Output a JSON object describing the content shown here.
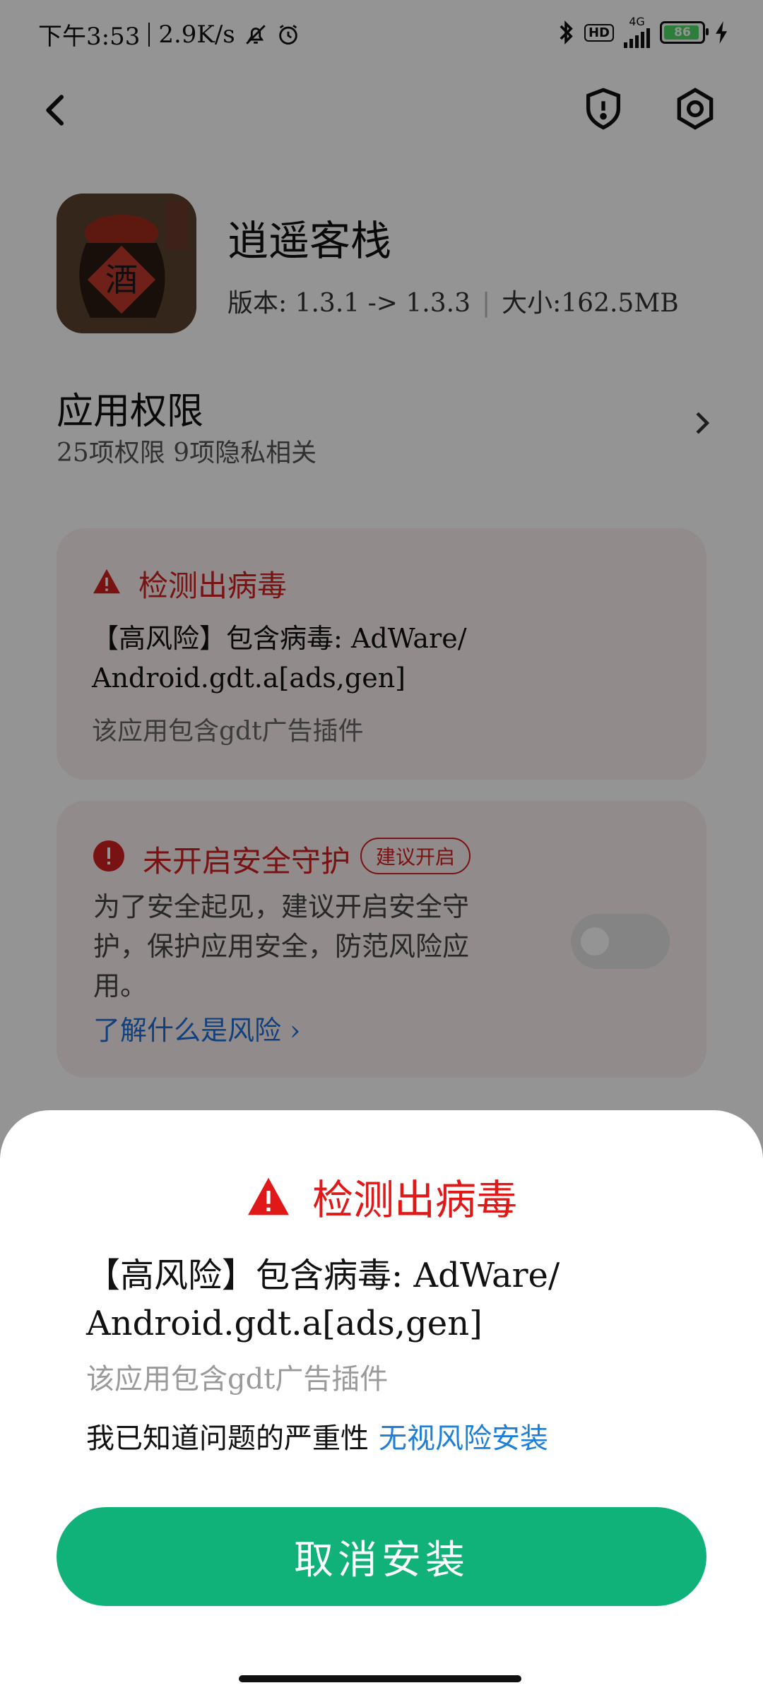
{
  "status_bar": {
    "time": "下午3:53",
    "net_speed": "2.9K/s",
    "network": "4G",
    "hd": "HD",
    "battery": "86"
  },
  "header": {
    "back_icon": "back-arrow-icon",
    "shield_icon": "shield-alert-icon",
    "settings_icon": "settings-icon"
  },
  "app": {
    "name": "逍遥客栈",
    "version": "版本: 1.3.1 -> 1.3.3",
    "size": "大小:162.5MB",
    "icon_text": "酒"
  },
  "permissions": {
    "title": "应用权限",
    "summary": "25项权限  9项隐私相关"
  },
  "virus_card": {
    "title": "检测出病毒",
    "risk_line1": "【高风险】包含病毒: AdWare/",
    "risk_line2": "Android.gdt.a[ads,gen]",
    "desc": "该应用包含gdt广告插件"
  },
  "protection_card": {
    "title": "未开启安全守护",
    "chip": "建议开启",
    "body": "为了安全起见，建议开启安全守护，保护应用安全，防范风险应用。",
    "link": "了解什么是风险 ›",
    "toggle_on": false
  },
  "sheet": {
    "title": "检测出病毒",
    "risk_line1": "【高风险】包含病毒: AdWare/",
    "risk_line2": "Android.gdt.a[ads,gen]",
    "desc": "该应用包含gdt广告插件",
    "ack_text": "我已知道问题的严重性",
    "ack_link": "无视风险安装",
    "cancel_label": "取消安装"
  },
  "colors": {
    "danger": "#e01818",
    "primary_button": "#10b27a",
    "link": "#1e7fd8"
  }
}
